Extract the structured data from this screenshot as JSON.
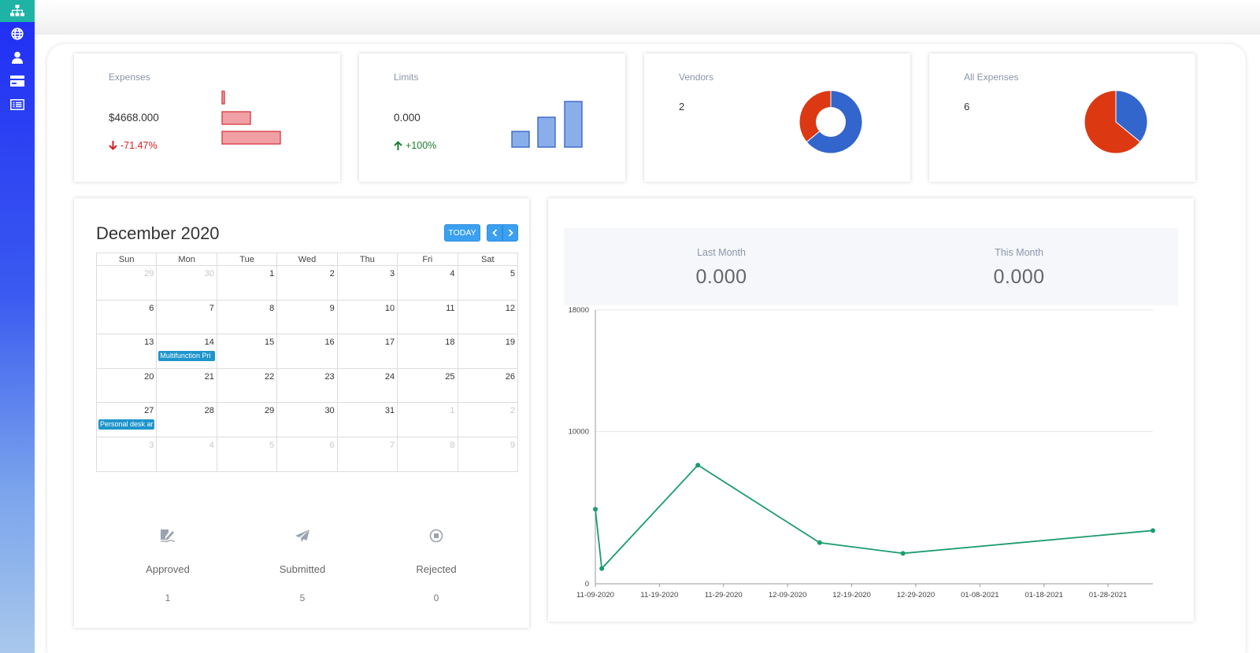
{
  "sidebar": {
    "items": [
      {
        "icon": "sitemap-icon",
        "active": true
      },
      {
        "icon": "globe-icon",
        "active": false
      },
      {
        "icon": "user-icon",
        "active": false
      },
      {
        "icon": "credit-card-icon",
        "active": false
      },
      {
        "icon": "list-alt-icon",
        "active": false
      }
    ]
  },
  "stats": {
    "expenses": {
      "title": "Expenses",
      "value": "$4668.000",
      "change": "-71.47%",
      "bars": [
        3,
        36,
        74
      ]
    },
    "limits": {
      "title": "Limits",
      "value": "0.000",
      "change": "+100%",
      "bars": [
        20,
        38,
        58
      ]
    },
    "vendors": {
      "title": "Vendors",
      "value": "2",
      "slices": [
        {
          "fraction": 0.64,
          "color": "#3366cc"
        },
        {
          "fraction": 0.36,
          "color": "#dc3912"
        }
      ]
    },
    "all_expenses": {
      "title": "All Expenses",
      "value": "6",
      "slices": [
        {
          "fraction": 0.36,
          "color": "#3366cc"
        },
        {
          "fraction": 0.64,
          "color": "#dc3912"
        }
      ]
    }
  },
  "calendar": {
    "title": "December 2020",
    "today_label": "TODAY",
    "weekdays": [
      "Sun",
      "Mon",
      "Tue",
      "Wed",
      "Thu",
      "Fri",
      "Sat"
    ],
    "weeks": [
      [
        {
          "d": "29",
          "o": true
        },
        {
          "d": "30",
          "o": true
        },
        {
          "d": "1"
        },
        {
          "d": "2"
        },
        {
          "d": "3"
        },
        {
          "d": "4"
        },
        {
          "d": "5"
        }
      ],
      [
        {
          "d": "6"
        },
        {
          "d": "7"
        },
        {
          "d": "8"
        },
        {
          "d": "9"
        },
        {
          "d": "10"
        },
        {
          "d": "11"
        },
        {
          "d": "12"
        }
      ],
      [
        {
          "d": "13"
        },
        {
          "d": "14",
          "event": "Multifunction Pri"
        },
        {
          "d": "15"
        },
        {
          "d": "16"
        },
        {
          "d": "17"
        },
        {
          "d": "18"
        },
        {
          "d": "19"
        }
      ],
      [
        {
          "d": "20"
        },
        {
          "d": "21"
        },
        {
          "d": "22"
        },
        {
          "d": "23"
        },
        {
          "d": "24"
        },
        {
          "d": "25"
        },
        {
          "d": "26"
        }
      ],
      [
        {
          "d": "27",
          "event": "Personal desk ar"
        },
        {
          "d": "28"
        },
        {
          "d": "29"
        },
        {
          "d": "30"
        },
        {
          "d": "31"
        },
        {
          "d": "1",
          "o": true
        },
        {
          "d": "2",
          "o": true
        }
      ],
      [
        {
          "d": "3",
          "o": true
        },
        {
          "d": "4",
          "o": true
        },
        {
          "d": "5",
          "o": true
        },
        {
          "d": "6",
          "o": true
        },
        {
          "d": "7",
          "o": true
        },
        {
          "d": "8",
          "o": true
        },
        {
          "d": "9",
          "o": true
        }
      ]
    ]
  },
  "statuses": [
    {
      "label": "Approved",
      "count": "1",
      "icon": "edit-signature-icon"
    },
    {
      "label": "Submitted",
      "count": "5",
      "icon": "paper-plane-icon"
    },
    {
      "label": "Rejected",
      "count": "0",
      "icon": "stop-circle-icon"
    }
  ],
  "summary": {
    "last_month_label": "Last Month",
    "last_month_value": "0.000",
    "this_month_label": "This Month",
    "this_month_value": "0.000"
  },
  "chart_data": {
    "type": "line",
    "x": [
      "11-09-2020",
      "11-10-2020",
      "11-25-2020",
      "12-14-2020",
      "12-27-2020",
      "02-04-2021"
    ],
    "series": [
      {
        "values": [
          4900,
          1000,
          7800,
          2700,
          2000,
          3500
        ],
        "color": "#1a9c6b"
      }
    ],
    "xticks": [
      "11-09-2020",
      "11-19-2020",
      "11-29-2020",
      "12-09-2020",
      "12-19-2020",
      "12-29-2020",
      "01-08-2021",
      "01-18-2021",
      "01-28-2021"
    ],
    "yticks": [
      "0",
      "10000",
      "18000"
    ],
    "ylim": [
      0,
      18000
    ],
    "grid": true
  }
}
